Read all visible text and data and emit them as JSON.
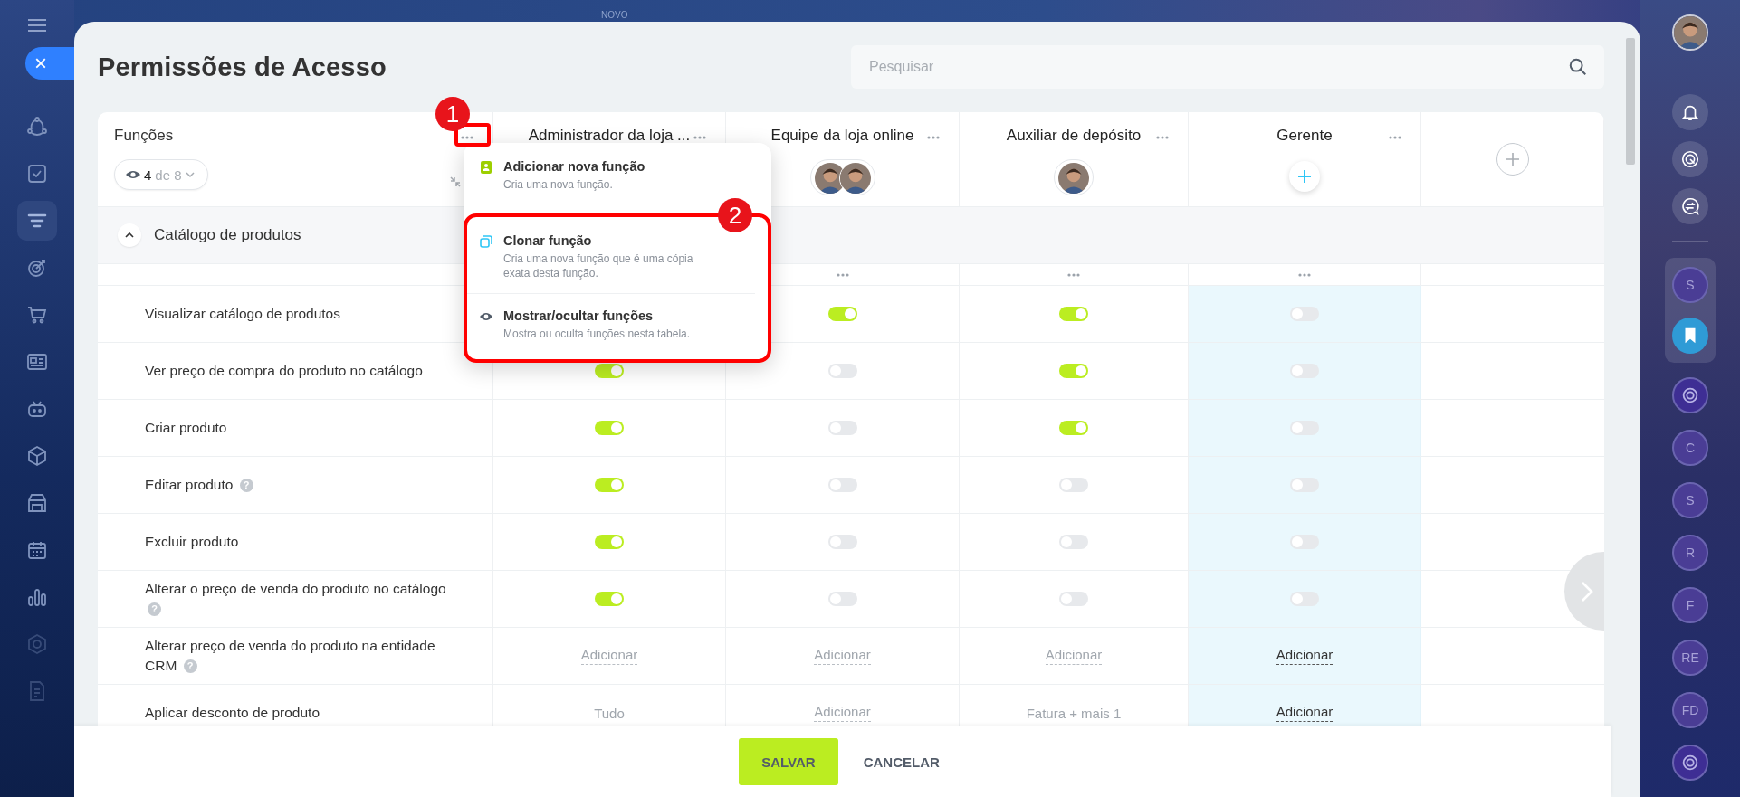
{
  "left_sidebar": {
    "items": [
      {
        "kind": "flow",
        "selected": false
      },
      {
        "kind": "tasks",
        "selected": false
      },
      {
        "kind": "filter",
        "selected": true
      },
      {
        "kind": "target",
        "selected": false
      },
      {
        "kind": "cart",
        "selected": false
      },
      {
        "kind": "card",
        "selected": false
      },
      {
        "kind": "robot",
        "selected": false
      },
      {
        "kind": "box",
        "selected": false
      },
      {
        "kind": "store",
        "selected": false
      },
      {
        "kind": "calendar",
        "selected": false
      },
      {
        "kind": "chart",
        "selected": false
      },
      {
        "kind": "hexagon",
        "selected": false
      },
      {
        "kind": "doc",
        "selected": false
      }
    ]
  },
  "close_button": {
    "label": "×"
  },
  "top_bar": {
    "badge": "NOVO"
  },
  "page": {
    "title": "Permissões de Acesso"
  },
  "search": {
    "placeholder": "Pesquisar"
  },
  "table": {
    "header": {
      "label": "Funções",
      "visible_count": "4",
      "visible_total": "de 8"
    },
    "roles": [
      {
        "name": "Administrador da loja ...",
        "selected": false
      },
      {
        "name": "Equipe da loja online",
        "selected": false,
        "kind": "members"
      },
      {
        "name": "Auxiliar de depósito",
        "selected": false,
        "kind": "members"
      },
      {
        "name": "Gerente",
        "selected": true,
        "kind": "empty"
      }
    ],
    "section": {
      "title": "Catálogo de produtos",
      "expanded": true
    },
    "rows": [
      {
        "label": "Visualizar catálogo de produtos",
        "kind": "toggle",
        "cells": [
          {},
          {
            "on": true
          },
          {
            "on": true
          },
          {
            "on": false
          }
        ]
      },
      {
        "label": "Ver preço de compra do produto no catálogo",
        "kind": "toggle",
        "cells": [
          {
            "on": true
          },
          {
            "on": false
          },
          {
            "on": true
          },
          {
            "on": false
          }
        ]
      },
      {
        "label": "Criar produto",
        "kind": "toggle",
        "cells": [
          {
            "on": true
          },
          {
            "on": false
          },
          {
            "on": true
          },
          {
            "on": false
          }
        ]
      },
      {
        "label": "Editar produto",
        "help": "?",
        "kind": "toggle",
        "cells": [
          {
            "on": true
          },
          {
            "on": false
          },
          {
            "on": false
          },
          {
            "on": false
          }
        ]
      },
      {
        "label": "Excluir produto",
        "kind": "toggle",
        "cells": [
          {
            "on": true
          },
          {
            "on": false
          },
          {
            "on": false
          },
          {
            "on": false
          }
        ]
      },
      {
        "label": "Alterar o preço de venda do produto no catálogo",
        "help": "?",
        "kind": "toggle",
        "cells": [
          {
            "on": true
          },
          {
            "on": false
          },
          {
            "on": false
          },
          {
            "on": false
          }
        ]
      },
      {
        "label": "Alterar preço de venda do produto na entidade CRM",
        "help": "?",
        "kind": "value",
        "cells": [
          {
            "text": "Adicionar",
            "kind": "link"
          },
          {
            "text": "Adicionar",
            "kind": "link"
          },
          {
            "text": "Adicionar",
            "kind": "link"
          },
          {
            "text": "Adicionar",
            "kind": "link"
          }
        ]
      },
      {
        "label": "Aplicar desconto de produto",
        "kind": "value",
        "cells": [
          {
            "text": "Tudo",
            "kind": "text"
          },
          {
            "text": "Adicionar",
            "kind": "link"
          },
          {
            "text": "Fatura + mais 1",
            "kind": "text"
          },
          {
            "text": "Adicionar",
            "kind": "link"
          }
        ]
      }
    ]
  },
  "menu": {
    "items": [
      {
        "kind": "add",
        "title": "Adicionar nova função",
        "description": "Cria uma nova função."
      },
      {
        "kind": "clone",
        "title": "Clonar função",
        "description": "Cria uma nova função que é uma cópia exata desta função."
      },
      {
        "kind": "eye",
        "title": "Mostrar/ocultar funções",
        "description": "Mostra ou oculta funções nesta tabela."
      }
    ]
  },
  "annotations": [
    {
      "label": "1"
    },
    {
      "label": "2"
    }
  ],
  "footer": {
    "buttons": [
      {
        "label": "SALVAR",
        "kind": "primary"
      },
      {
        "label": "CANCELAR",
        "kind": "link"
      }
    ]
  },
  "right_sidebar": {
    "top": [
      {
        "kind": "avatar"
      },
      {
        "kind": "bell"
      },
      {
        "kind": "copilot"
      },
      {
        "kind": "chat"
      }
    ],
    "pinned": [
      {
        "kind": "letter",
        "text": "S"
      },
      {
        "kind": "bookmark"
      }
    ],
    "chats": [
      {
        "kind": "logo"
      },
      {
        "kind": "letter",
        "text": "C"
      },
      {
        "kind": "letter",
        "text": "S"
      },
      {
        "kind": "letter",
        "text": "R"
      },
      {
        "kind": "letter",
        "text": "F"
      },
      {
        "kind": "letter",
        "text": "RE"
      },
      {
        "kind": "letter",
        "text": "FD"
      },
      {
        "kind": "logo"
      }
    ]
  }
}
